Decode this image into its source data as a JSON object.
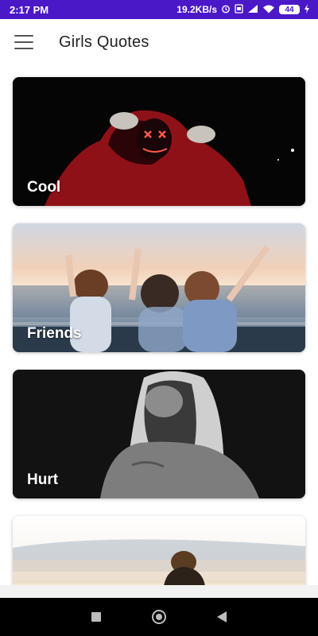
{
  "status_bar": {
    "time": "2:17 PM",
    "speed": "19.2KB/s",
    "battery": "44"
  },
  "app_bar": {
    "title": "Girls Quotes"
  },
  "categories": [
    {
      "label": "Cool"
    },
    {
      "label": "Friends"
    },
    {
      "label": "Hurt"
    },
    {
      "label": ""
    }
  ],
  "colors": {
    "status_bar": "#4b18c7",
    "background": "#ffffff"
  }
}
